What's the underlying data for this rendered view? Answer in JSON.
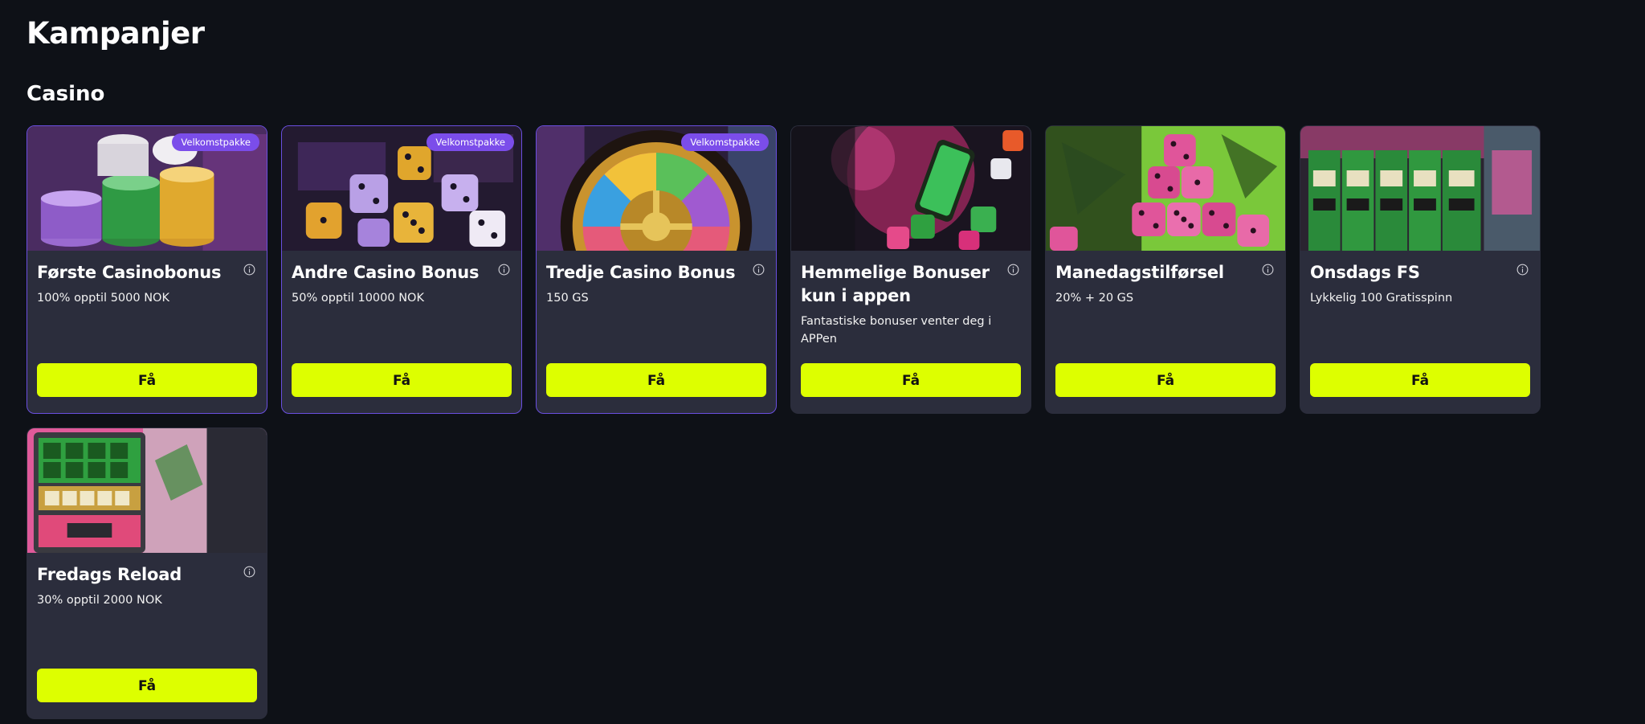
{
  "page": {
    "title": "Kampanjer",
    "section_title": "Casino"
  },
  "colors": {
    "background": "#0e1117",
    "card": "#2b2d3c",
    "accent_button": "#ddff00",
    "badge": "#7b4dea",
    "featured_border": "#6a4fe0"
  },
  "cards": [
    {
      "title": "Første Casinobonus",
      "description": "100% opptil 5000 NOK",
      "badge": "Velkomstpakke",
      "button": "Få",
      "image": "casino-chips-image"
    },
    {
      "title": "Andre Casino Bonus",
      "description": "50% opptil 10000 NOK",
      "badge": "Velkomstpakke",
      "button": "Få",
      "image": "dice-image"
    },
    {
      "title": "Tredje Casino Bonus",
      "description": "150 GS",
      "badge": "Velkomstpakke",
      "button": "Få",
      "image": "roulette-wheel-image"
    },
    {
      "title": "Hemmelige Bonuser kun i appen",
      "description": "Fantastiske bonuser venter deg i APPen",
      "badge": "",
      "button": "Få",
      "image": "phone-dice-image"
    },
    {
      "title": "Manedagstilførsel",
      "description": "20% + 20 GS",
      "badge": "",
      "button": "Få",
      "image": "pink-dice-image"
    },
    {
      "title": "Onsdags FS",
      "description": "Lykkelig 100 Gratisspinn",
      "badge": "",
      "button": "Få",
      "image": "slot-machines-image"
    },
    {
      "title": "Fredags Reload",
      "description": "30% opptil 2000 NOK",
      "badge": "",
      "button": "Få",
      "image": "slot-machine-graffiti-image"
    }
  ]
}
